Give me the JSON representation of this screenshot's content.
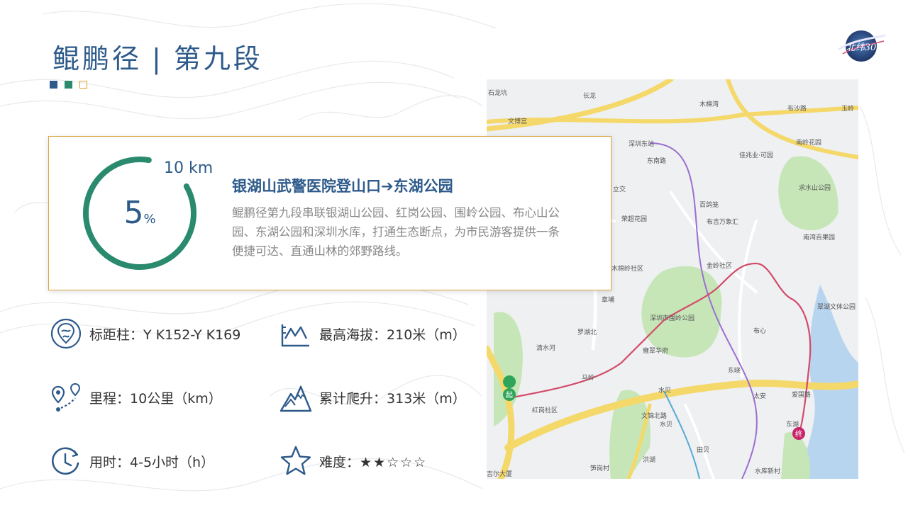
{
  "header": {
    "title_part1": "鲲鹏径",
    "title_sep": "|",
    "title_part2": "第九段",
    "logo_text": "北纬30"
  },
  "summary_card": {
    "progress_value": "5",
    "progress_unit": "%",
    "progress_fraction": 0.05,
    "distance_label": "10 km",
    "route_title": "银湖山武警医院登山口➔东湖公园",
    "route_description": "鲲鹏径第九段串联银湖山公园、红岗公园、围岭公园、布心山公园、东湖公园和深圳水库，打通生态断点，为市民游客提供一条便捷可达、直通山林的郊野路线。"
  },
  "stats": {
    "marker": {
      "label": "标距柱：",
      "value": "Y K152-Y K169"
    },
    "max_altitude": {
      "label": "最高海拔：",
      "value": "210米（m）"
    },
    "distance": {
      "label": "里程：",
      "value": "10公里（km）"
    },
    "ascent": {
      "label": "累计爬升：",
      "value": "313米（m）"
    },
    "duration": {
      "label": "用时：",
      "value": "4-5小时（h）"
    },
    "difficulty": {
      "label": "难度：",
      "value": "★★☆☆☆"
    }
  },
  "map": {
    "labels": [
      "石龙坑",
      "长龙",
      "木棉湾",
      "布沙路",
      "玉岭",
      "文博宫",
      "深圳东站",
      "南岭花园",
      "东南路",
      "佳兆业·可园",
      "立交",
      "求水山公园",
      "百鸽笼",
      "荣超花园",
      "布吉万象汇",
      "南湾百果园",
      "金岭社区",
      "木棉岭社区",
      "章埔",
      "翠湖文体公园",
      "罗湖北",
      "布心",
      "清水河",
      "雍翠华府",
      "马岭",
      "东晓",
      "水贝",
      "太安",
      "红岗社区",
      "文锦北路",
      "水贝",
      "爱国路",
      "东湖",
      "田贝",
      "笋岗村",
      "洪湖",
      "水库新村",
      "吉尔大厦",
      "深圳市围岭公园"
    ],
    "start_marker": "起",
    "end_marker": "终"
  },
  "colors": {
    "primary": "#2d5a8a",
    "green": "#2a8a6e",
    "accent": "#e0a020"
  }
}
